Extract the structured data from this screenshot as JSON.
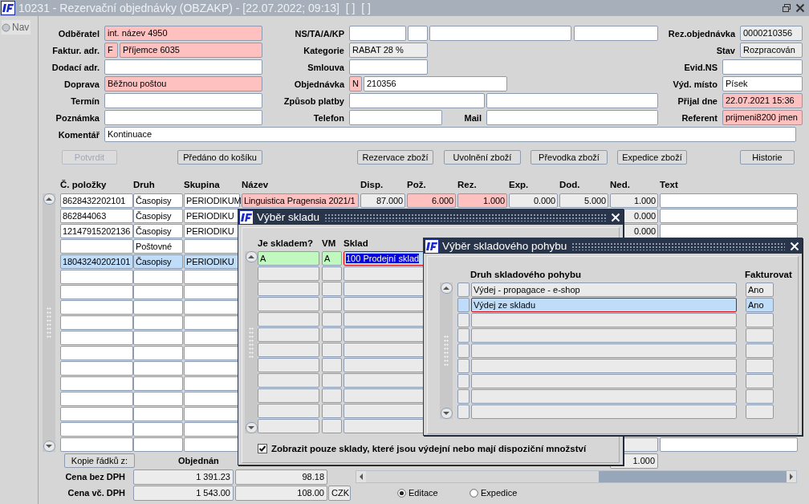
{
  "window": {
    "title": "10231 - Rezervační objednávky (OBZAKP) - [22.07.2022; 09:13]  [ ]  [ ]"
  },
  "nav": {
    "label": "Nav"
  },
  "header": {
    "rows": [
      {
        "groups": [
          {
            "label": "Odběratel",
            "fields": [
              {
                "value": "int. název 4950",
                "color": "#ffc0c0"
              }
            ]
          },
          {
            "label": "NS/TA/A/KP",
            "fields": [
              {
                "color": "#ffffff"
              },
              {
                "color": "#ffffff"
              },
              {
                "color": "#ffffff"
              },
              {
                "color": "#ffffff"
              }
            ]
          },
          {
            "label": "Rez.objednávka",
            "fields": [
              {
                "value": "0000210356",
                "color": "#ececec"
              }
            ]
          }
        ]
      },
      {
        "groups": [
          {
            "label": "Faktur. adr.",
            "fields": [
              {
                "value": "F",
                "color": "#ffc0c0"
              },
              {
                "value": "Příjemce 6035",
                "color": "#ffc0c0"
              }
            ]
          },
          {
            "label": "Kategorie",
            "fields": [
              {
                "value": "RABAT 28 %",
                "color": "#ececec"
              }
            ]
          },
          {
            "label": "Stav",
            "fields": [
              {
                "value": "Rozpracován",
                "color": "#ececec"
              }
            ]
          }
        ]
      },
      {
        "groups": [
          {
            "label": "Dodací adr.",
            "fields": [
              {
                "color": "#ffffff"
              }
            ]
          },
          {
            "label": "Smlouva",
            "fields": [
              {
                "color": "#ffffff"
              }
            ]
          },
          {
            "label": "Evid.NS",
            "fields": [
              {
                "color": "#ffffff"
              }
            ]
          }
        ]
      },
      {
        "groups": [
          {
            "label": "Doprava",
            "fields": [
              {
                "value": "Běžnou poštou",
                "color": "#ffc0c0"
              }
            ]
          },
          {
            "label": "Objednávka",
            "fields": [
              {
                "value": "N",
                "color": "#ffc0c0"
              },
              {
                "value": "210356",
                "color": "#ffffff"
              }
            ]
          },
          {
            "label": "Výd. místo",
            "fields": [
              {
                "value": "Písek",
                "color": "#ffffff"
              }
            ]
          }
        ]
      },
      {
        "groups": [
          {
            "label": "Termín",
            "fields": [
              {
                "color": "#ffffff"
              }
            ]
          },
          {
            "label": "Způsob platby",
            "fields": [
              {
                "color": "#ffffff"
              },
              {
                "color": "#ffffff"
              }
            ]
          },
          {
            "label": "Přijal dne",
            "fields": [
              {
                "value": "22.07.2021 15:36",
                "color": "#ffc0c0"
              }
            ]
          }
        ]
      },
      {
        "groups": [
          {
            "label": "Poznámka",
            "fields": [
              {
                "color": "#ffffff"
              }
            ]
          },
          {
            "label": "Telefon",
            "fields": [
              {
                "color": "#ffffff"
              }
            ]
          },
          {
            "label": "Mail",
            "fields": [
              {
                "color": "#ffffff"
              }
            ]
          },
          {
            "label": "Referent",
            "fields": [
              {
                "value": "prijmeni8200 jmen",
                "color": "#ffc0c0"
              }
            ]
          }
        ]
      },
      {
        "groups": [
          {
            "label": "Komentář",
            "fields": [
              {
                "value": "Kontinuace",
                "color": "#ffffff"
              }
            ]
          }
        ]
      }
    ]
  },
  "buttons": [
    {
      "label": "Potvrdit",
      "disabled": true
    },
    {
      "label": "Předáno do košíku",
      "disabled": false
    },
    {
      "label": "Rezervace zboží",
      "disabled": false
    },
    {
      "label": "Uvolnění zboží",
      "disabled": false
    },
    {
      "label": "Převodka zboží",
      "disabled": false
    },
    {
      "label": "Expedice zboží",
      "disabled": false
    },
    {
      "label": "Historie",
      "disabled": false
    }
  ],
  "table": {
    "columns": [
      {
        "label": "Č. položky",
        "color": "#ffffff"
      },
      {
        "label": "Druh",
        "color": "#ffffff"
      },
      {
        "label": "Skupina",
        "color": "#ffffff"
      },
      {
        "label": "Název",
        "color": "#ffc0c0"
      },
      {
        "label": "Disp.",
        "color": "#ececec"
      },
      {
        "label": "Pož.",
        "color": "#ffc0c0"
      },
      {
        "label": "Rez.",
        "color": "#ffc0c0"
      },
      {
        "label": "Exp.",
        "color": "#ececec"
      },
      {
        "label": "Dod.",
        "color": "#ececec"
      },
      {
        "label": "Ned.",
        "color": "#ececec"
      },
      {
        "label": "Text",
        "color": "#ffffff"
      }
    ],
    "rows": [
      {
        "selected": false,
        "cells": [
          "8628432202101",
          "Časopisy",
          "PERIODIKUM",
          "Linguistica Pragensia 2021/1",
          "87.000",
          "6.000",
          "1.000",
          "0.000",
          "5.000",
          "1.000"
        ]
      },
      {
        "selected": false,
        "cells": [
          "862844063",
          "Časopisy",
          "PERIODIKU",
          null,
          null,
          null,
          null,
          null,
          null,
          "0.000"
        ]
      },
      {
        "selected": false,
        "cells": [
          "12147915202136",
          "Časopisy",
          "PERIODIKU",
          null,
          null,
          null,
          null,
          null,
          null,
          "0.000"
        ]
      },
      {
        "selected": false,
        "cells": [
          null,
          "Poštovné"
        ]
      },
      {
        "selected": true,
        "cells": [
          "18043240202101",
          "Časopisy",
          "PERIODIKU"
        ]
      }
    ]
  },
  "footer": {
    "copy_button": "Kopie řádků z:",
    "ordered_label": "Objednán",
    "ned_total": "1.000",
    "price_rows": [
      {
        "label": "Cena bez DPH",
        "values": [
          "1 391.23",
          "98.18"
        ]
      },
      {
        "label": "Cena vč. DPH",
        "values": [
          "1 543.00",
          "108.00"
        ],
        "currency": "CZK"
      }
    ]
  },
  "mode": [
    {
      "label": "Editace",
      "selected": true
    },
    {
      "label": "Expedice",
      "selected": false
    }
  ],
  "dialogs": [
    {
      "title": "Výběr skladu",
      "columns": [
        "Je skladem?",
        "VM",
        "Sklad"
      ],
      "rows": [
        {
          "selected": true,
          "cells": [
            "A",
            "A",
            "100 Prodejní sklad"
          ]
        }
      ],
      "checkbox": {
        "label": "Zobrazit pouze sklady, které jsou výdejní nebo mají dispoziční množství",
        "checked": true
      }
    },
    {
      "title": "Výběr skladového pohybu",
      "columns": [
        "Druh skladového pohybu",
        "Fakturovat"
      ],
      "rows": [
        {
          "selected": false,
          "cells": [
            "Výdej - propagace - e-shop",
            "Ano"
          ]
        },
        {
          "selected": true,
          "cells": [
            "Výdej ze skladu",
            "Ano"
          ]
        }
      ]
    }
  ]
}
